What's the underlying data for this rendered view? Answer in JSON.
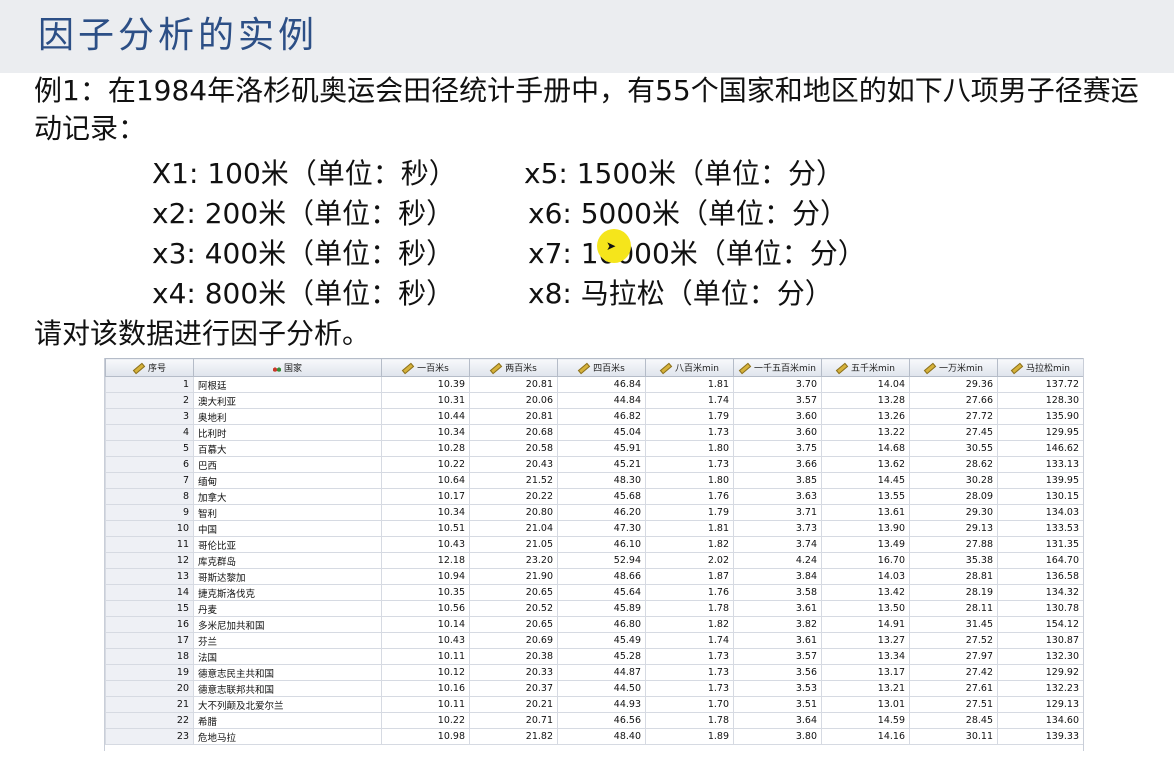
{
  "slide": {
    "title": "因子分析的实例",
    "intro": "例1：在1984年洛杉矶奥运会田径统计手册中，有55个国家和地区的如下八项男子径赛运动记录：",
    "variables": [
      "X1: 100米（单位：秒）",
      "x2: 200米（单位：秒）",
      "x3: 400米（单位：秒）",
      "x4: 800米（单位：秒）",
      "x5: 1500米（单位：分）",
      "x6: 5000米（单位：分）",
      "x7: 10000米（单位：分）",
      "x8: 马拉松（单位：分）"
    ],
    "closing": "请对该数据进行因子分析。"
  },
  "table": {
    "columns": [
      "序号",
      "国家",
      "一百米s",
      "两百米s",
      "四百米s",
      "八百米min",
      "一千五百米min",
      "五千米min",
      "一万米min",
      "马拉松min"
    ],
    "column_icons": [
      "scale-ruler-icon",
      "nominal-measure-icon",
      "scale-ruler-icon",
      "scale-ruler-icon",
      "scale-ruler-icon",
      "scale-ruler-icon",
      "scale-ruler-icon",
      "scale-ruler-icon",
      "scale-ruler-icon",
      "scale-ruler-icon"
    ],
    "rows": [
      [
        "1",
        "阿根廷",
        "10.39",
        "20.81",
        "46.84",
        "1.81",
        "3.70",
        "14.04",
        "29.36",
        "137.72"
      ],
      [
        "2",
        "澳大利亚",
        "10.31",
        "20.06",
        "44.84",
        "1.74",
        "3.57",
        "13.28",
        "27.66",
        "128.30"
      ],
      [
        "3",
        "奥地利",
        "10.44",
        "20.81",
        "46.82",
        "1.79",
        "3.60",
        "13.26",
        "27.72",
        "135.90"
      ],
      [
        "4",
        "比利时",
        "10.34",
        "20.68",
        "45.04",
        "1.73",
        "3.60",
        "13.22",
        "27.45",
        "129.95"
      ],
      [
        "5",
        "百慕大",
        "10.28",
        "20.58",
        "45.91",
        "1.80",
        "3.75",
        "14.68",
        "30.55",
        "146.62"
      ],
      [
        "6",
        "巴西",
        "10.22",
        "20.43",
        "45.21",
        "1.73",
        "3.66",
        "13.62",
        "28.62",
        "133.13"
      ],
      [
        "7",
        "缅甸",
        "10.64",
        "21.52",
        "48.30",
        "1.80",
        "3.85",
        "14.45",
        "30.28",
        "139.95"
      ],
      [
        "8",
        "加拿大",
        "10.17",
        "20.22",
        "45.68",
        "1.76",
        "3.63",
        "13.55",
        "28.09",
        "130.15"
      ],
      [
        "9",
        "智利",
        "10.34",
        "20.80",
        "46.20",
        "1.79",
        "3.71",
        "13.61",
        "29.30",
        "134.03"
      ],
      [
        "10",
        "中国",
        "10.51",
        "21.04",
        "47.30",
        "1.81",
        "3.73",
        "13.90",
        "29.13",
        "133.53"
      ],
      [
        "11",
        "哥伦比亚",
        "10.43",
        "21.05",
        "46.10",
        "1.82",
        "3.74",
        "13.49",
        "27.88",
        "131.35"
      ],
      [
        "12",
        "库克群岛",
        "12.18",
        "23.20",
        "52.94",
        "2.02",
        "4.24",
        "16.70",
        "35.38",
        "164.70"
      ],
      [
        "13",
        "哥斯达黎加",
        "10.94",
        "21.90",
        "48.66",
        "1.87",
        "3.84",
        "14.03",
        "28.81",
        "136.58"
      ],
      [
        "14",
        "捷克斯洛伐克",
        "10.35",
        "20.65",
        "45.64",
        "1.76",
        "3.58",
        "13.42",
        "28.19",
        "134.32"
      ],
      [
        "15",
        "丹麦",
        "10.56",
        "20.52",
        "45.89",
        "1.78",
        "3.61",
        "13.50",
        "28.11",
        "130.78"
      ],
      [
        "16",
        "多米尼加共和国",
        "10.14",
        "20.65",
        "46.80",
        "1.82",
        "3.82",
        "14.91",
        "31.45",
        "154.12"
      ],
      [
        "17",
        "芬兰",
        "10.43",
        "20.69",
        "45.49",
        "1.74",
        "3.61",
        "13.27",
        "27.52",
        "130.87"
      ],
      [
        "18",
        "法国",
        "10.11",
        "20.38",
        "45.28",
        "1.73",
        "3.57",
        "13.34",
        "27.97",
        "132.30"
      ],
      [
        "19",
        "德意志民主共和国",
        "10.12",
        "20.33",
        "44.87",
        "1.73",
        "3.56",
        "13.17",
        "27.42",
        "129.92"
      ],
      [
        "20",
        "德意志联邦共和国",
        "10.16",
        "20.37",
        "44.50",
        "1.73",
        "3.53",
        "13.21",
        "27.61",
        "132.23"
      ],
      [
        "21",
        "大不列颠及北爱尔兰",
        "10.11",
        "20.21",
        "44.93",
        "1.70",
        "3.51",
        "13.01",
        "27.51",
        "129.13"
      ],
      [
        "22",
        "希腊",
        "10.22",
        "20.71",
        "46.56",
        "1.78",
        "3.64",
        "14.59",
        "28.45",
        "134.60"
      ],
      [
        "23",
        "危地马拉",
        "10.98",
        "21.82",
        "48.40",
        "1.89",
        "3.80",
        "14.16",
        "30.11",
        "139.33"
      ]
    ]
  },
  "colors": {
    "title": "#2c4f86",
    "title_bar": "#ebedf0",
    "pointer_highlight": "#f5e51b"
  }
}
